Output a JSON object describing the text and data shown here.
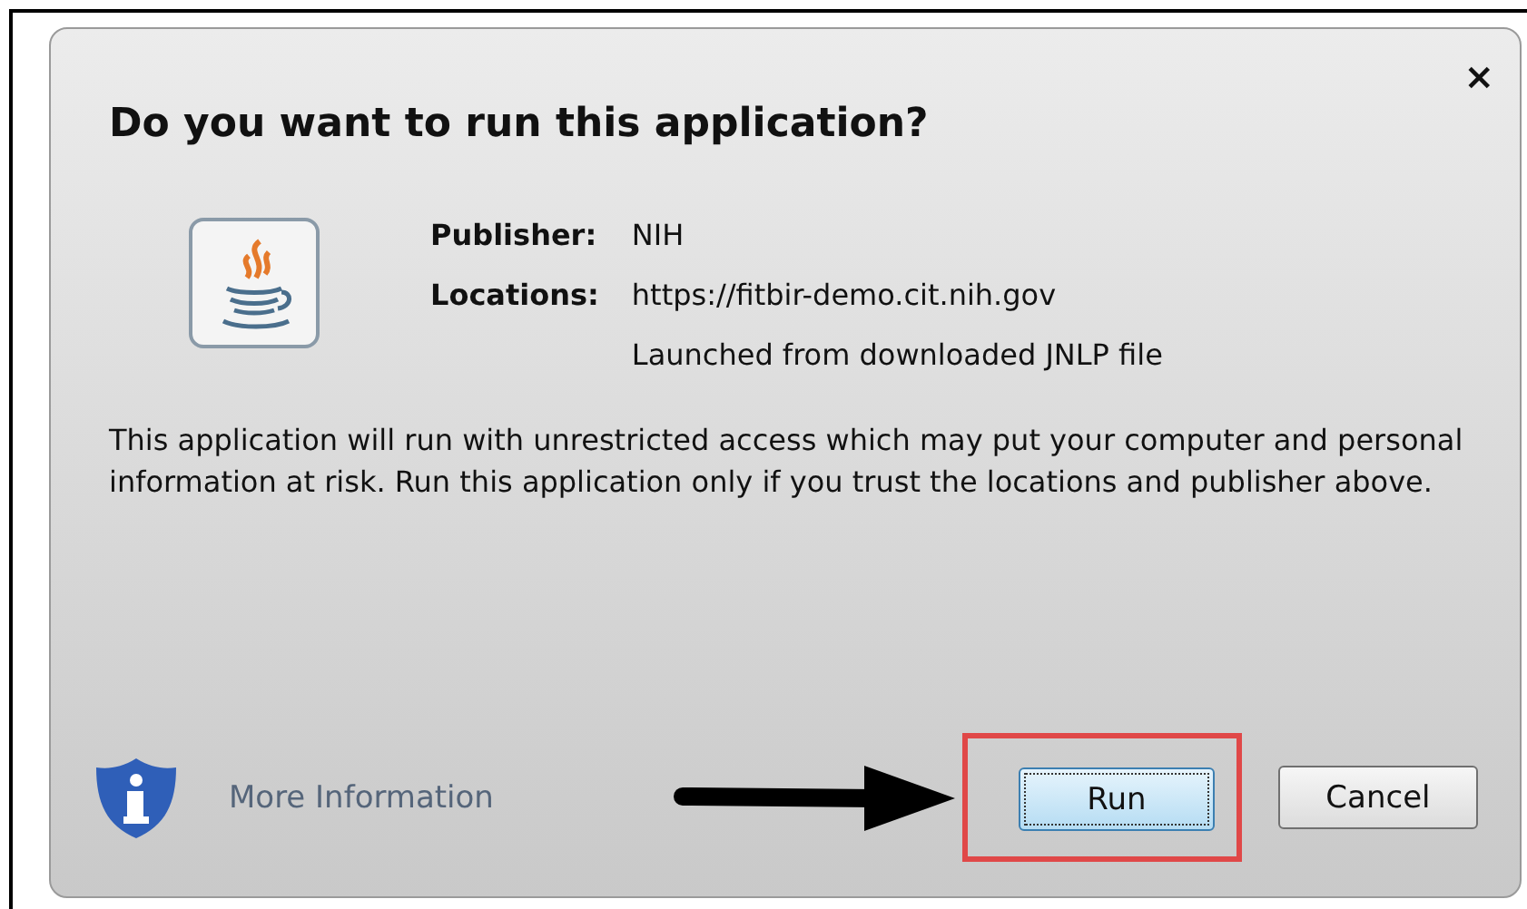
{
  "dialog": {
    "title": "Do you want to run this application?",
    "close": "×"
  },
  "details": [
    {
      "label": "Publisher:",
      "values": [
        "NIH"
      ]
    },
    {
      "label": "Locations:",
      "values": [
        "https://fitbir-demo.cit.nih.gov",
        "Launched from downloaded JNLP file"
      ]
    }
  ],
  "message": "This application will run with unrestricted access which may put your computer and personal information at risk. Run this application only if you trust the locations and publisher above.",
  "more_info": "More Information",
  "buttons": [
    {
      "label": "Run",
      "focused": true,
      "highlighted": true
    },
    {
      "label": "Cancel",
      "focused": false,
      "highlighted": false
    }
  ]
}
